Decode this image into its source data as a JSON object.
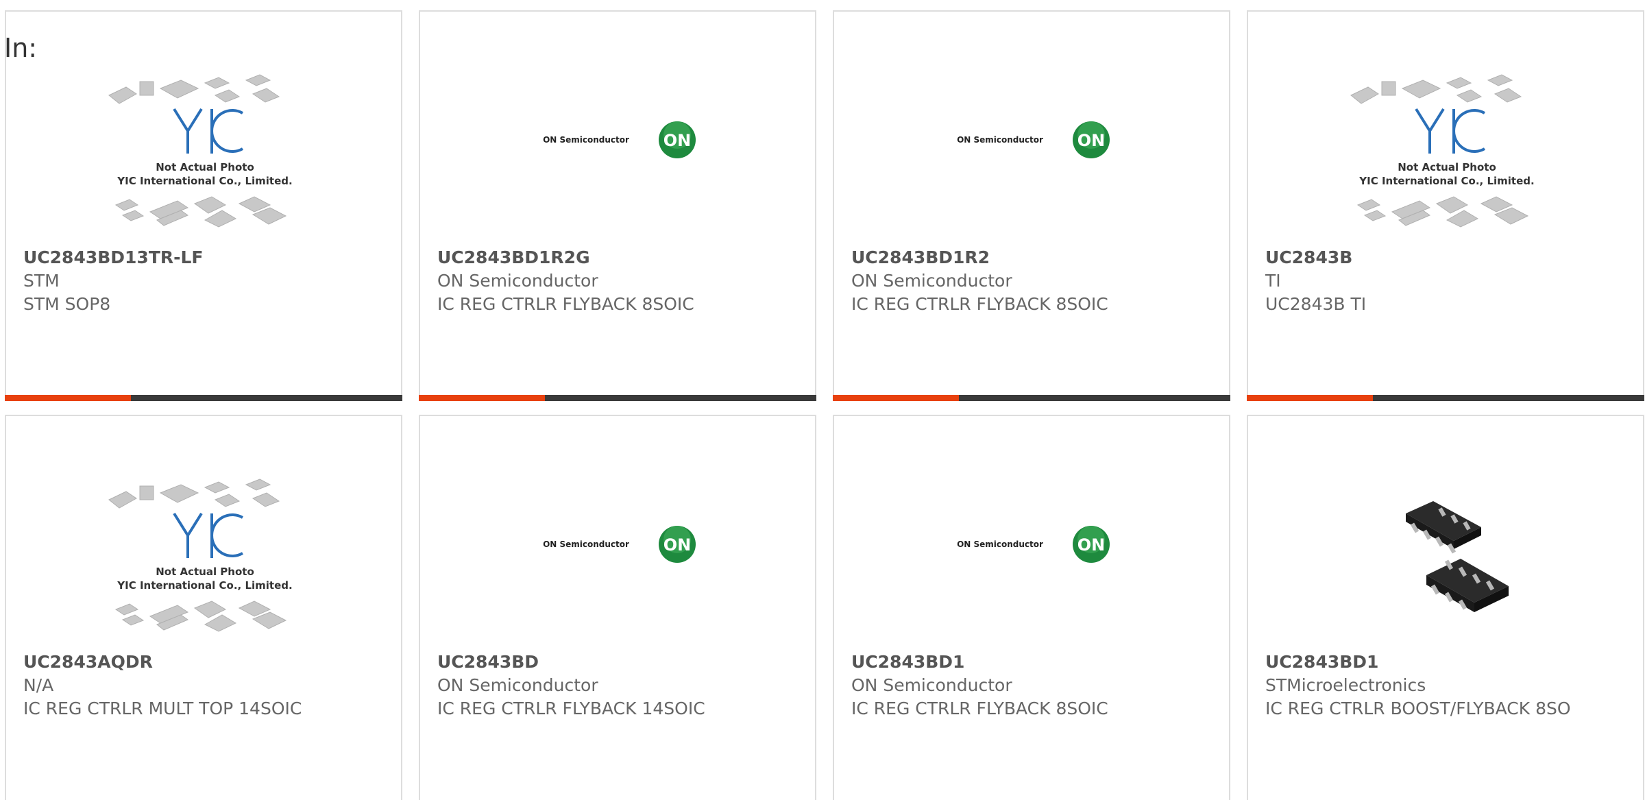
{
  "page": {
    "prefix": "In:"
  },
  "brand": {
    "accent": "#e8410e",
    "dark": "#3a3a3a",
    "on_green": "#1e8a3e",
    "yic_blue": "#2a6fb8"
  },
  "placeholders": {
    "yic_line1": "Not Actual Photo",
    "yic_line2": "YIC International Co., Limited.",
    "on_text": "ON Semiconductor",
    "on_badge": "ON"
  },
  "products": [
    {
      "part": "UC2843BD13TR-LF",
      "mfr": "STM",
      "desc": "STM SOP8",
      "image": "yic-placeholder"
    },
    {
      "part": "UC2843BD1R2G",
      "mfr": "ON Semiconductor",
      "desc": "IC REG CTRLR FLYBACK 8SOIC",
      "image": "on-semi-logo"
    },
    {
      "part": "UC2843BD1R2",
      "mfr": "ON Semiconductor",
      "desc": "IC REG CTRLR FLYBACK 8SOIC",
      "image": "on-semi-logo"
    },
    {
      "part": "UC2843B",
      "mfr": "TI",
      "desc": "UC2843B TI",
      "image": "yic-placeholder"
    },
    {
      "part": "UC2843AQDR",
      "mfr": "N/A",
      "desc": "IC REG CTRLR MULT TOP 14SOIC",
      "image": "yic-placeholder"
    },
    {
      "part": "UC2843BD",
      "mfr": "ON Semiconductor",
      "desc": "IC REG CTRLR FLYBACK 14SOIC",
      "image": "on-semi-logo"
    },
    {
      "part": "UC2843BD1",
      "mfr": "ON Semiconductor",
      "desc": "IC REG CTRLR FLYBACK 8SOIC",
      "image": "on-semi-logo"
    },
    {
      "part": "UC2843BD1",
      "mfr": "STMicroelectronics",
      "desc": "IC REG CTRLR BOOST/FLYBACK 8SO",
      "image": "soic-chip-photo"
    }
  ]
}
